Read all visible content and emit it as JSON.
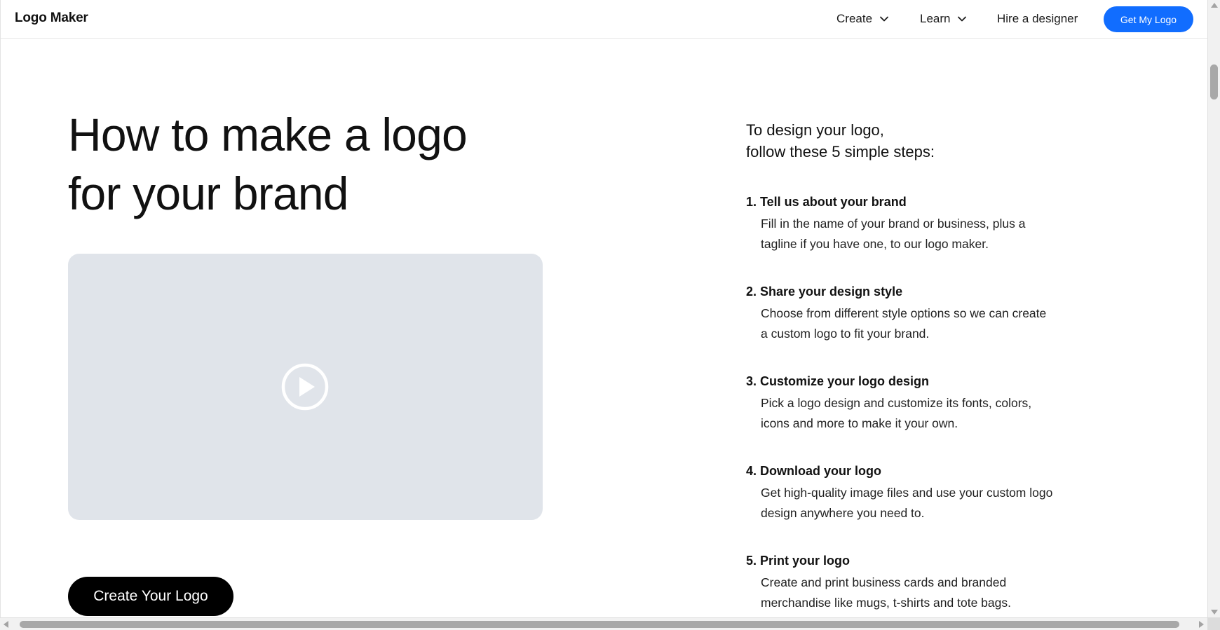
{
  "header": {
    "brand": "Logo Maker",
    "nav": [
      {
        "label": "Create",
        "has_dropdown": true
      },
      {
        "label": "Learn",
        "has_dropdown": true
      },
      {
        "label": "Hire a designer",
        "has_dropdown": false
      }
    ],
    "cta_label": "Get My Logo",
    "cta_color": "#116dff"
  },
  "hero": {
    "headline_line1": "How to make a logo",
    "headline_line2": "for your brand",
    "video_placeholder_color": "#e0e4ea",
    "play_icon": "play-circle-icon",
    "cta_label": "Create Your Logo"
  },
  "steps": {
    "intro_line1": "To design your logo,",
    "intro_line2": "follow these 5 simple steps:",
    "items": [
      {
        "title": "1. Tell us about your brand",
        "desc": "Fill in the name of your brand or business, plus a tagline if you have one, to our logo maker."
      },
      {
        "title": "2. Share your design style",
        "desc": "Choose from different style options so we can create a custom logo to fit your brand."
      },
      {
        "title": "3. Customize your logo design",
        "desc": "Pick a logo design and customize its fonts, colors, icons and more to make it your own."
      },
      {
        "title": "4. Download your logo",
        "desc": "Get high-quality image files and use your custom logo design anywhere you need to."
      },
      {
        "title": "5. Print your logo",
        "desc": "Create and print business cards and branded merchandise like mugs, t-shirts and tote bags."
      }
    ]
  }
}
